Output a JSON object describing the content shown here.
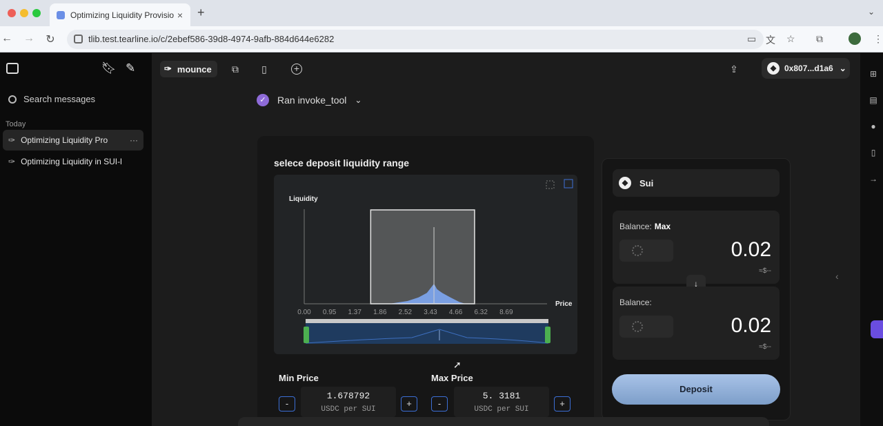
{
  "browser": {
    "tab_title": "Optimizing Liquidity Provision",
    "url": "tlib.test.tearline.io/c/2ebef586-39d8-4974-9afb-884d644e6282"
  },
  "sidebar": {
    "search_label": "Search messages",
    "section_label": "Today",
    "conversations": [
      {
        "title": "Optimizing Liquidity Pro",
        "active": true
      },
      {
        "title": "Optimizing Liquidity in SUI-l",
        "active": false
      }
    ]
  },
  "topbar": {
    "agent_name": "mounce",
    "wallet_address": "0x807...d1a6"
  },
  "message": {
    "tool_status": "Ran invoke_tool"
  },
  "range_card": {
    "title": "selece deposit liquidity range",
    "min_price_label": "Min Price",
    "max_price_label": "Max Price",
    "min_price_value": "1.678792",
    "max_price_value": "5.  3181",
    "unit": "USDC per SUI",
    "minus_label": "-",
    "plus_label": "+"
  },
  "chart_data": {
    "type": "area",
    "ylabel": "Liquidity",
    "xlabel": "Price",
    "x_ticks": [
      "0.00",
      "0.95",
      "1.37",
      "1.86",
      "2.52",
      "3.43",
      "4.66",
      "6.32",
      "8.69"
    ],
    "selected_range": [
      1.68,
      5.9
    ],
    "current_price": 3.6,
    "distribution": [
      {
        "x": 2.1,
        "y": 0.0
      },
      {
        "x": 2.6,
        "y": 0.03
      },
      {
        "x": 3.0,
        "y": 0.07
      },
      {
        "x": 3.3,
        "y": 0.12
      },
      {
        "x": 3.5,
        "y": 0.19
      },
      {
        "x": 3.6,
        "y": 0.22
      },
      {
        "x": 3.75,
        "y": 0.16
      },
      {
        "x": 4.0,
        "y": 0.12
      },
      {
        "x": 4.4,
        "y": 0.07
      },
      {
        "x": 4.9,
        "y": 0.02
      },
      {
        "x": 5.3,
        "y": 0.0
      }
    ],
    "colors": {
      "fill": "#5b8ff0",
      "selection": "#d9d9d9",
      "handle": "#4caf50"
    }
  },
  "deposit_card": {
    "token": "Sui",
    "balance_label": "Balance:",
    "max_label": "Max",
    "amount_top": "0.02",
    "amount_bottom": "0.02",
    "usd_placeholder": "≈$--",
    "deposit_label": "Deposit"
  },
  "colors": {
    "accent": "#8e6bd8",
    "deposit": "#9ab6de",
    "step_border": "#3c6fd6"
  }
}
